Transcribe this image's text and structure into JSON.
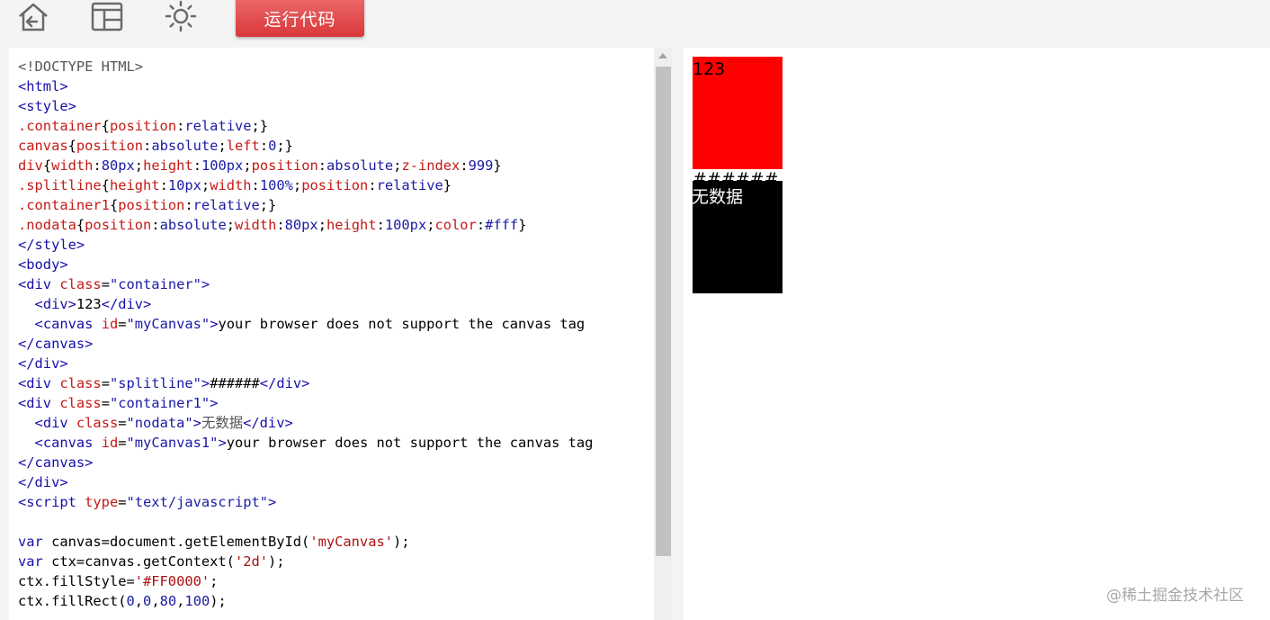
{
  "toolbar": {
    "icons": [
      "home-back-icon",
      "layout-icon",
      "brightness-icon"
    ],
    "run_label": "运行代码",
    "accent": "#e04a4b"
  },
  "editor": {
    "lines": [
      [
        {
          "c": "t-gray",
          "t": "<!DOCTYPE HTML>"
        }
      ],
      [
        {
          "c": "t-tag",
          "t": "<html>"
        }
      ],
      [
        {
          "c": "t-tag",
          "t": "<style>"
        }
      ],
      [
        {
          "c": "t-sel",
          "t": ".container"
        },
        {
          "c": "t-text",
          "t": "{"
        },
        {
          "c": "t-prop",
          "t": "position"
        },
        {
          "c": "t-text",
          "t": ":"
        },
        {
          "c": "t-val",
          "t": "relative"
        },
        {
          "c": "t-text",
          "t": ";}"
        }
      ],
      [
        {
          "c": "t-sel",
          "t": "canvas"
        },
        {
          "c": "t-text",
          "t": "{"
        },
        {
          "c": "t-prop",
          "t": "position"
        },
        {
          "c": "t-text",
          "t": ":"
        },
        {
          "c": "t-val",
          "t": "absolute"
        },
        {
          "c": "t-text",
          "t": ";"
        },
        {
          "c": "t-prop",
          "t": "left"
        },
        {
          "c": "t-text",
          "t": ":"
        },
        {
          "c": "t-num",
          "t": "0"
        },
        {
          "c": "t-text",
          "t": ";}"
        }
      ],
      [
        {
          "c": "t-sel",
          "t": "div"
        },
        {
          "c": "t-text",
          "t": "{"
        },
        {
          "c": "t-prop",
          "t": "width"
        },
        {
          "c": "t-text",
          "t": ":"
        },
        {
          "c": "t-num",
          "t": "80px"
        },
        {
          "c": "t-text",
          "t": ";"
        },
        {
          "c": "t-prop",
          "t": "height"
        },
        {
          "c": "t-text",
          "t": ":"
        },
        {
          "c": "t-num",
          "t": "100px"
        },
        {
          "c": "t-text",
          "t": ";"
        },
        {
          "c": "t-prop",
          "t": "position"
        },
        {
          "c": "t-text",
          "t": ":"
        },
        {
          "c": "t-val",
          "t": "absolute"
        },
        {
          "c": "t-text",
          "t": ";"
        },
        {
          "c": "t-prop",
          "t": "z-index"
        },
        {
          "c": "t-text",
          "t": ":"
        },
        {
          "c": "t-num",
          "t": "999"
        },
        {
          "c": "t-text",
          "t": "}"
        }
      ],
      [
        {
          "c": "t-sel",
          "t": ".splitline"
        },
        {
          "c": "t-text",
          "t": "{"
        },
        {
          "c": "t-prop",
          "t": "height"
        },
        {
          "c": "t-text",
          "t": ":"
        },
        {
          "c": "t-num",
          "t": "10px"
        },
        {
          "c": "t-text",
          "t": ";"
        },
        {
          "c": "t-prop",
          "t": "width"
        },
        {
          "c": "t-text",
          "t": ":"
        },
        {
          "c": "t-num",
          "t": "100%"
        },
        {
          "c": "t-text",
          "t": ";"
        },
        {
          "c": "t-prop",
          "t": "position"
        },
        {
          "c": "t-text",
          "t": ":"
        },
        {
          "c": "t-val",
          "t": "relative"
        },
        {
          "c": "t-text",
          "t": "}"
        }
      ],
      [
        {
          "c": "t-sel",
          "t": ".container1"
        },
        {
          "c": "t-text",
          "t": "{"
        },
        {
          "c": "t-prop",
          "t": "position"
        },
        {
          "c": "t-text",
          "t": ":"
        },
        {
          "c": "t-val",
          "t": "relative"
        },
        {
          "c": "t-text",
          "t": ";}"
        }
      ],
      [
        {
          "c": "t-sel",
          "t": ".nodata"
        },
        {
          "c": "t-text",
          "t": "{"
        },
        {
          "c": "t-prop",
          "t": "position"
        },
        {
          "c": "t-text",
          "t": ":"
        },
        {
          "c": "t-val",
          "t": "absolute"
        },
        {
          "c": "t-text",
          "t": ";"
        },
        {
          "c": "t-prop",
          "t": "width"
        },
        {
          "c": "t-text",
          "t": ":"
        },
        {
          "c": "t-num",
          "t": "80px"
        },
        {
          "c": "t-text",
          "t": ";"
        },
        {
          "c": "t-prop",
          "t": "height"
        },
        {
          "c": "t-text",
          "t": ":"
        },
        {
          "c": "t-num",
          "t": "100px"
        },
        {
          "c": "t-text",
          "t": ";"
        },
        {
          "c": "t-prop",
          "t": "color"
        },
        {
          "c": "t-text",
          "t": ":"
        },
        {
          "c": "t-val",
          "t": "#fff"
        },
        {
          "c": "t-text",
          "t": "}"
        }
      ],
      [
        {
          "c": "t-tag",
          "t": "</style>"
        }
      ],
      [
        {
          "c": "t-tag",
          "t": "<body>"
        }
      ],
      [
        {
          "c": "t-tag",
          "t": "<div "
        },
        {
          "c": "t-attr",
          "t": "class"
        },
        {
          "c": "t-text",
          "t": "="
        },
        {
          "c": "t-str",
          "t": "\"container\""
        },
        {
          "c": "t-tag",
          "t": ">"
        }
      ],
      [
        {
          "c": "t-text",
          "t": "  "
        },
        {
          "c": "t-tag",
          "t": "<div>"
        },
        {
          "c": "t-text",
          "t": "123"
        },
        {
          "c": "t-tag",
          "t": "</div>"
        }
      ],
      [
        {
          "c": "t-text",
          "t": "  "
        },
        {
          "c": "t-tag",
          "t": "<canvas "
        },
        {
          "c": "t-attr",
          "t": "id"
        },
        {
          "c": "t-text",
          "t": "="
        },
        {
          "c": "t-str",
          "t": "\"myCanvas\""
        },
        {
          "c": "t-tag",
          "t": ">"
        },
        {
          "c": "t-text",
          "t": "your browser does not support the canvas tag "
        },
        {
          "c": "t-tag",
          "t": "</canvas>"
        }
      ],
      [
        {
          "c": "t-tag",
          "t": "</div>"
        }
      ],
      [
        {
          "c": "t-tag",
          "t": "<div "
        },
        {
          "c": "t-attr",
          "t": "class"
        },
        {
          "c": "t-text",
          "t": "="
        },
        {
          "c": "t-str",
          "t": "\"splitline\""
        },
        {
          "c": "t-tag",
          "t": ">"
        },
        {
          "c": "t-text",
          "t": "######"
        },
        {
          "c": "t-tag",
          "t": "</div>"
        }
      ],
      [
        {
          "c": "t-tag",
          "t": "<div "
        },
        {
          "c": "t-attr",
          "t": "class"
        },
        {
          "c": "t-text",
          "t": "="
        },
        {
          "c": "t-str",
          "t": "\"container1\""
        },
        {
          "c": "t-tag",
          "t": ">"
        }
      ],
      [
        {
          "c": "t-text",
          "t": "  "
        },
        {
          "c": "t-tag",
          "t": "<div "
        },
        {
          "c": "t-attr",
          "t": "class"
        },
        {
          "c": "t-text",
          "t": "="
        },
        {
          "c": "t-str",
          "t": "\"nodata\""
        },
        {
          "c": "t-tag",
          "t": ">"
        },
        {
          "c": "t-cn",
          "t": "无数据"
        },
        {
          "c": "t-tag",
          "t": "</div>"
        }
      ],
      [
        {
          "c": "t-text",
          "t": "  "
        },
        {
          "c": "t-tag",
          "t": "<canvas "
        },
        {
          "c": "t-attr",
          "t": "id"
        },
        {
          "c": "t-text",
          "t": "="
        },
        {
          "c": "t-str",
          "t": "\"myCanvas1\""
        },
        {
          "c": "t-tag",
          "t": ">"
        },
        {
          "c": "t-text",
          "t": "your browser does not support the canvas tag "
        },
        {
          "c": "t-tag",
          "t": "</canvas>"
        }
      ],
      [
        {
          "c": "t-tag",
          "t": "</div>"
        }
      ],
      [
        {
          "c": "t-tag",
          "t": "<script "
        },
        {
          "c": "t-attr",
          "t": "type"
        },
        {
          "c": "t-text",
          "t": "="
        },
        {
          "c": "t-str",
          "t": "\"text/javascript\""
        },
        {
          "c": "t-tag",
          "t": ">"
        }
      ],
      [],
      [
        {
          "c": "t-kw",
          "t": "var"
        },
        {
          "c": "t-text",
          "t": " canvas=document.getElementById("
        },
        {
          "c": "t-jstr",
          "t": "'myCanvas'"
        },
        {
          "c": "t-text",
          "t": ");"
        }
      ],
      [
        {
          "c": "t-kw",
          "t": "var"
        },
        {
          "c": "t-text",
          "t": " ctx=canvas.getContext("
        },
        {
          "c": "t-jstr",
          "t": "'2d'"
        },
        {
          "c": "t-text",
          "t": ");"
        }
      ],
      [
        {
          "c": "t-text",
          "t": "ctx.fillStyle="
        },
        {
          "c": "t-jstr",
          "t": "'#FF0000'"
        },
        {
          "c": "t-text",
          "t": ";"
        }
      ],
      [
        {
          "c": "t-text",
          "t": "ctx.fillRect("
        },
        {
          "c": "t-num",
          "t": "0"
        },
        {
          "c": "t-text",
          "t": ","
        },
        {
          "c": "t-num",
          "t": "0"
        },
        {
          "c": "t-text",
          "t": ","
        },
        {
          "c": "t-num",
          "t": "80"
        },
        {
          "c": "t-text",
          "t": ","
        },
        {
          "c": "t-num",
          "t": "100"
        },
        {
          "c": "t-text",
          "t": ");"
        }
      ]
    ]
  },
  "preview": {
    "box1_text": "123",
    "box1_color": "#ff0000",
    "split_text": "######",
    "box2_text": "无数据",
    "box2_color": "#000000"
  },
  "watermark": "@稀土掘金技术社区"
}
